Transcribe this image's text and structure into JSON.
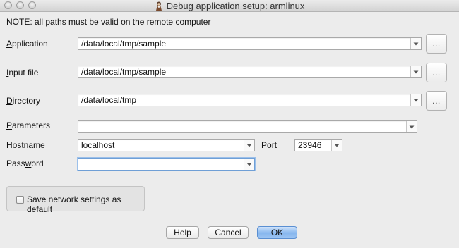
{
  "window": {
    "title": "Debug application setup: armlinux",
    "controls": [
      "close",
      "minimize",
      "zoom"
    ]
  },
  "note": "NOTE: all paths must be valid on the remote computer",
  "fields": {
    "application": {
      "label_mnemonic": "A",
      "label_rest": "pplication",
      "value": "/data/local/tmp/sample",
      "browse_label": "..."
    },
    "input_file": {
      "label_mnemonic": "I",
      "label_rest": "nput file",
      "value": "/data/local/tmp/sample",
      "browse_label": "..."
    },
    "directory": {
      "label_mnemonic": "D",
      "label_rest": "irectory",
      "value": "/data/local/tmp",
      "browse_label": "..."
    },
    "parameters": {
      "label_mnemonic": "P",
      "label_rest": "arameters",
      "value": ""
    },
    "hostname": {
      "label_mnemonic": "H",
      "label_rest": "ostname",
      "value": "localhost"
    },
    "port": {
      "label_start": "Po",
      "label_mnemonic": "r",
      "label_rest": "t",
      "value": "23946"
    },
    "password": {
      "label_start": "Pass",
      "label_mnemonic": "w",
      "label_rest": "ord",
      "value": ""
    }
  },
  "save_settings": {
    "label": "Save network settings as default",
    "checked": false
  },
  "buttons": {
    "help": "Help",
    "cancel": "Cancel",
    "ok": "OK"
  },
  "colors": {
    "window_bg": "#ececec",
    "focus_ring": "#6f9fd6",
    "default_button": "#86b6ee"
  },
  "icons": {
    "app_icon": "ida-debugger-icon",
    "dropdown": "chevron-down-icon"
  }
}
